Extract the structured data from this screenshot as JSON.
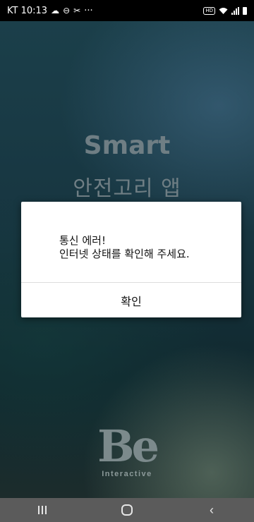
{
  "status_bar": {
    "carrier_time": "KT 10:13",
    "more": "···",
    "icons": [
      "cloud-icon",
      "minus-circle-icon",
      "scissors-icon",
      "hd-icon",
      "wifi-icon",
      "signal-icon",
      "battery-icon"
    ]
  },
  "app": {
    "title": "Smart",
    "subtitle": "안전고리 앱",
    "logo": {
      "mark": "Be",
      "text": "Interactive"
    }
  },
  "dialog": {
    "line1": "통신 에러!",
    "line2": "인터넷 상태를 확인해 주세요.",
    "ok_label": "확인"
  },
  "nav_bar": {
    "back_glyph": "‹"
  }
}
